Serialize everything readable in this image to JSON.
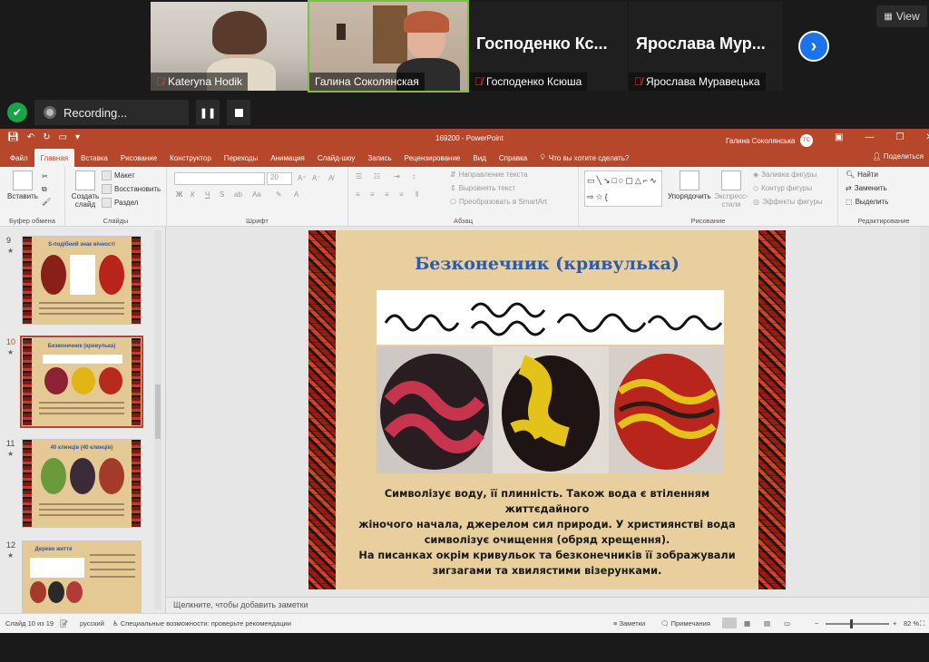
{
  "zoom": {
    "participants": [
      {
        "name": "Kateryna Hodik",
        "video": true
      },
      {
        "name": "Галина Соколянская",
        "video": true
      },
      {
        "name": "Господенко Ксюша",
        "display": "Господенко  Кс...",
        "video": false
      },
      {
        "name": "Ярослава Муравецька",
        "display": "Ярослава  Мур...",
        "video": false
      }
    ],
    "view_label": "View",
    "recording_label": "Recording...",
    "pause_icon": "pause-icon",
    "stop_icon": "stop-icon"
  },
  "ppt": {
    "doc_title": "169200  -  PowerPoint",
    "user_name": "Галина Соколянська",
    "user_initials": "ГС",
    "tabs": [
      "Файл",
      "Главная",
      "Вставка",
      "Рисование",
      "Конструктор",
      "Переходы",
      "Анимация",
      "Слайд-шоу",
      "Запись",
      "Рецензирование",
      "Вид",
      "Справка"
    ],
    "active_tab": "Главная",
    "tell_me": "Что вы хотите сделать?",
    "share": "Поделиться",
    "ribbon": {
      "clipboard": {
        "paste": "Вставить",
        "label": "Буфер обмена"
      },
      "slides": {
        "new_slide": "Создать слайд",
        "layout": "Макет",
        "reset": "Восстановить",
        "section": "Раздел",
        "label": "Слайды"
      },
      "font": {
        "label": "Шрифт",
        "bold": "Ж",
        "italic": "К",
        "underline": "Ч",
        "strike": "S",
        "size": "20"
      },
      "paragraph": {
        "label": "Абзац",
        "text_direction": "Направление текста",
        "align_text": "Выровнять текст",
        "smartart": "Преобразовать в SmartArt"
      },
      "drawing": {
        "arrange": "Упорядочить",
        "quick_styles": "Экспресс-стили",
        "fill": "Заливка фигуры",
        "outline": "Контур фигуры",
        "effects": "Эффекты фигуры",
        "label": "Рисование"
      },
      "editing": {
        "find": "Найти",
        "replace": "Заменить",
        "select": "Выделить",
        "label": "Редактирование"
      }
    },
    "thumbnails": [
      {
        "num": "9",
        "title": "S-подібний знак вічності"
      },
      {
        "num": "10",
        "title": "Безконечник (кривулька)",
        "active": true
      },
      {
        "num": "11",
        "title": "40 клинців (40 клинців)"
      },
      {
        "num": "12",
        "title": "Дерево життя"
      }
    ],
    "slide": {
      "title": "Безконечник (кривулька)",
      "lines": [
        "Символізує воду, її плинність. Також вода є втіленням життєдайного",
        "жіночого начала, джерелом сил природи. У християнстві вода",
        "символізує очищення (обряд хрещення).",
        "На писанках окрім кривульок та безконечників її зображували",
        "зигзагами та хвилястими візерунками."
      ]
    },
    "notes_placeholder": "Щелкните, чтобы добавить заметки",
    "status": {
      "slide_info": "Слайд 10 из 19",
      "language": "русский",
      "accessibility": "Специальные возможности: проверьте рекомендации",
      "notes": "Заметки",
      "comments": "Примечания",
      "zoom": "82 %"
    }
  }
}
